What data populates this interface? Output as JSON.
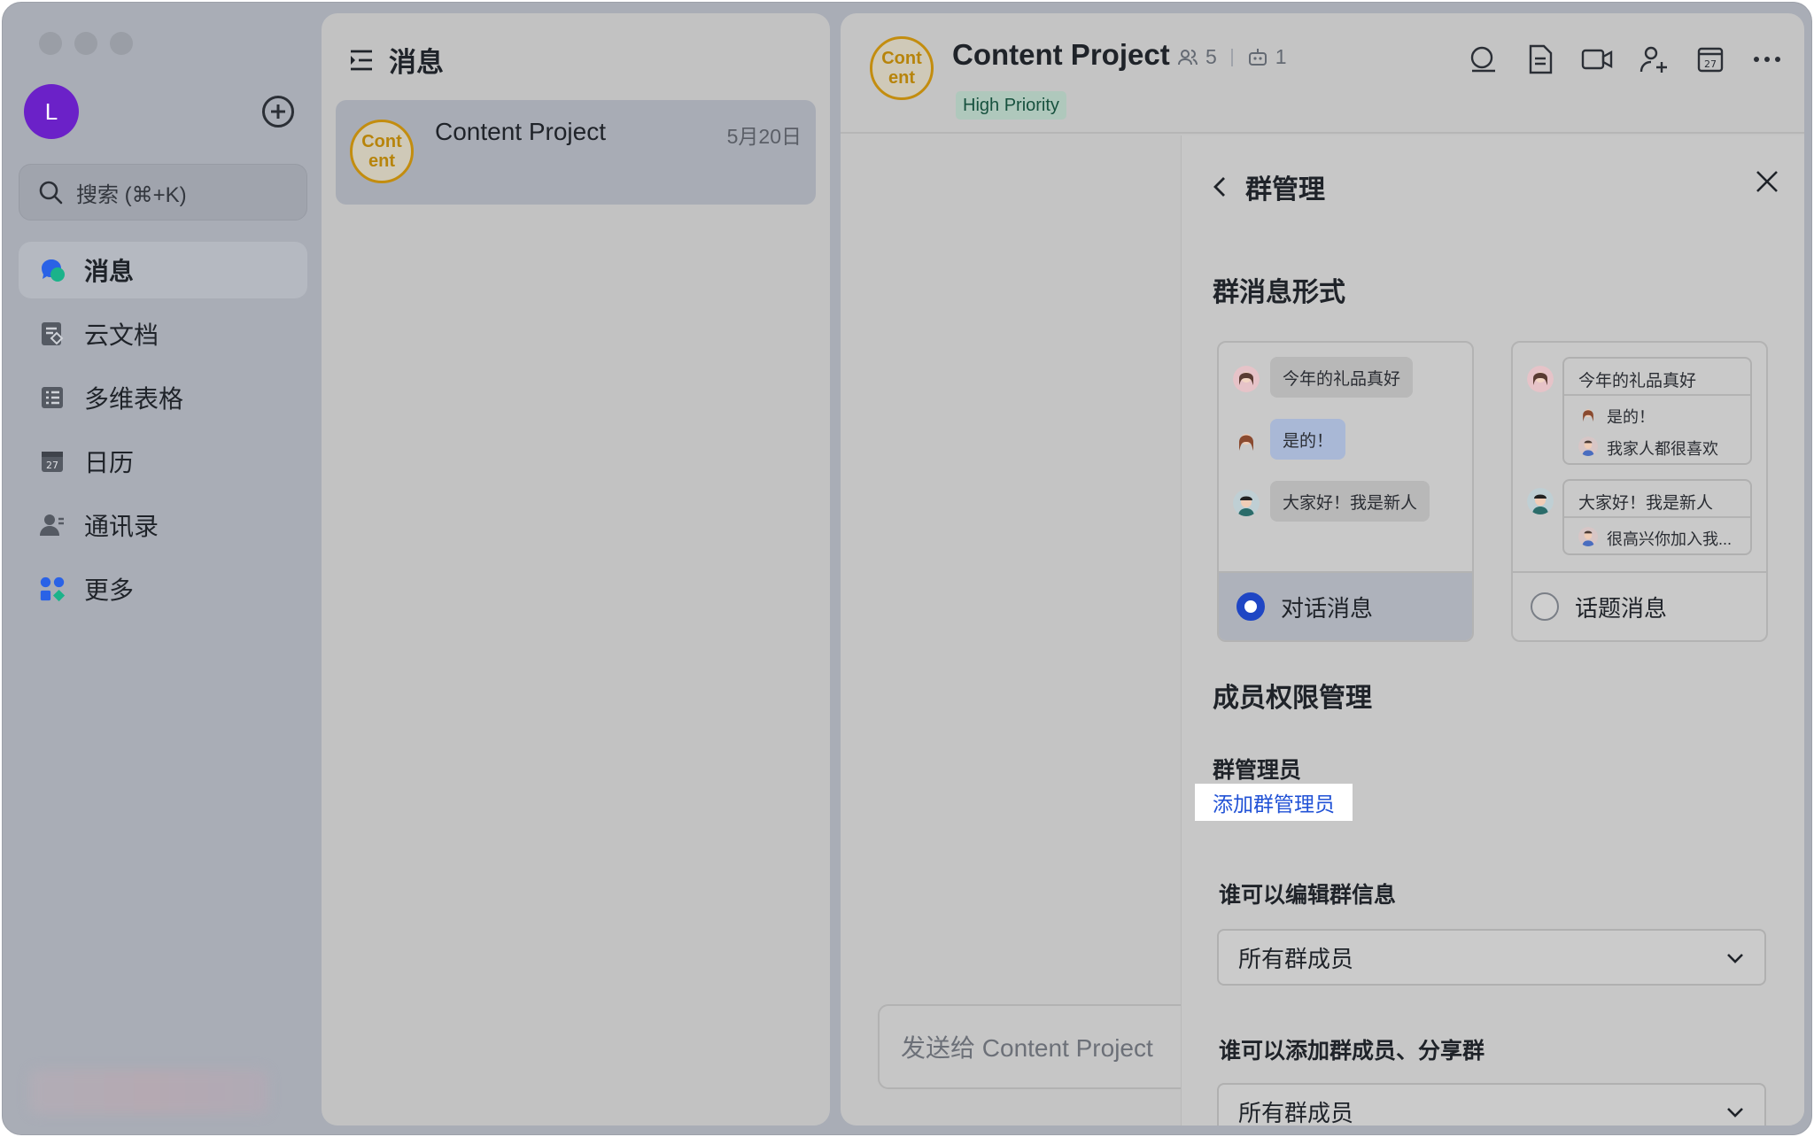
{
  "sidebar": {
    "avatar_initial": "L",
    "search_placeholder": "搜索 (⌘+K)",
    "items": [
      {
        "label": "消息",
        "icon": "message-icon",
        "active": true
      },
      {
        "label": "云文档",
        "icon": "docs-icon"
      },
      {
        "label": "多维表格",
        "icon": "base-icon"
      },
      {
        "label": "日历",
        "icon": "calendar-icon"
      },
      {
        "label": "通讯录",
        "icon": "contacts-icon"
      },
      {
        "label": "更多",
        "icon": "more-apps-icon"
      }
    ]
  },
  "message_list": {
    "title": "消息",
    "conversations": [
      {
        "avatar_text": "Cont ent",
        "name": "Content Project",
        "date": "5月20日"
      }
    ]
  },
  "chat": {
    "avatar_text": "Cont ent",
    "title": "Content Project",
    "member_count": "5",
    "bot_count": "1",
    "tag": "High Priority",
    "composer_placeholder": "发送给 Content Project",
    "toolbar_icons": [
      "search-icon",
      "doc-icon",
      "video-icon",
      "add-member-icon",
      "calendar-icon",
      "more-icon"
    ]
  },
  "panel": {
    "title": "群管理",
    "message_format_title": "群消息形式",
    "card_chat": {
      "option_label": "对话消息",
      "selected": true,
      "bubbles": [
        "今年的礼品真好",
        "是的！",
        "大家好！我是新人"
      ]
    },
    "card_topic": {
      "option_label": "话题消息",
      "selected": false,
      "thread1": [
        "今年的礼品真好",
        "是的！",
        "我家人都很喜欢"
      ],
      "thread2": [
        "大家好！我是新人",
        "很高兴你加入我..."
      ]
    },
    "permissions_title": "成员权限管理",
    "admins_label": "群管理员",
    "add_admin_link": "添加群管理员",
    "edit_info_label": "谁可以编辑群信息",
    "edit_info_value": "所有群成员",
    "add_members_label": "谁可以添加群成员、分享群",
    "add_members_value": "所有群成员"
  },
  "colors": {
    "accent": "#1f46c4",
    "link": "#2152d6",
    "avatar_purple": "#6b21c8",
    "project_gold": "#c38d0f",
    "tag_green_bg": "#afc8bc"
  }
}
